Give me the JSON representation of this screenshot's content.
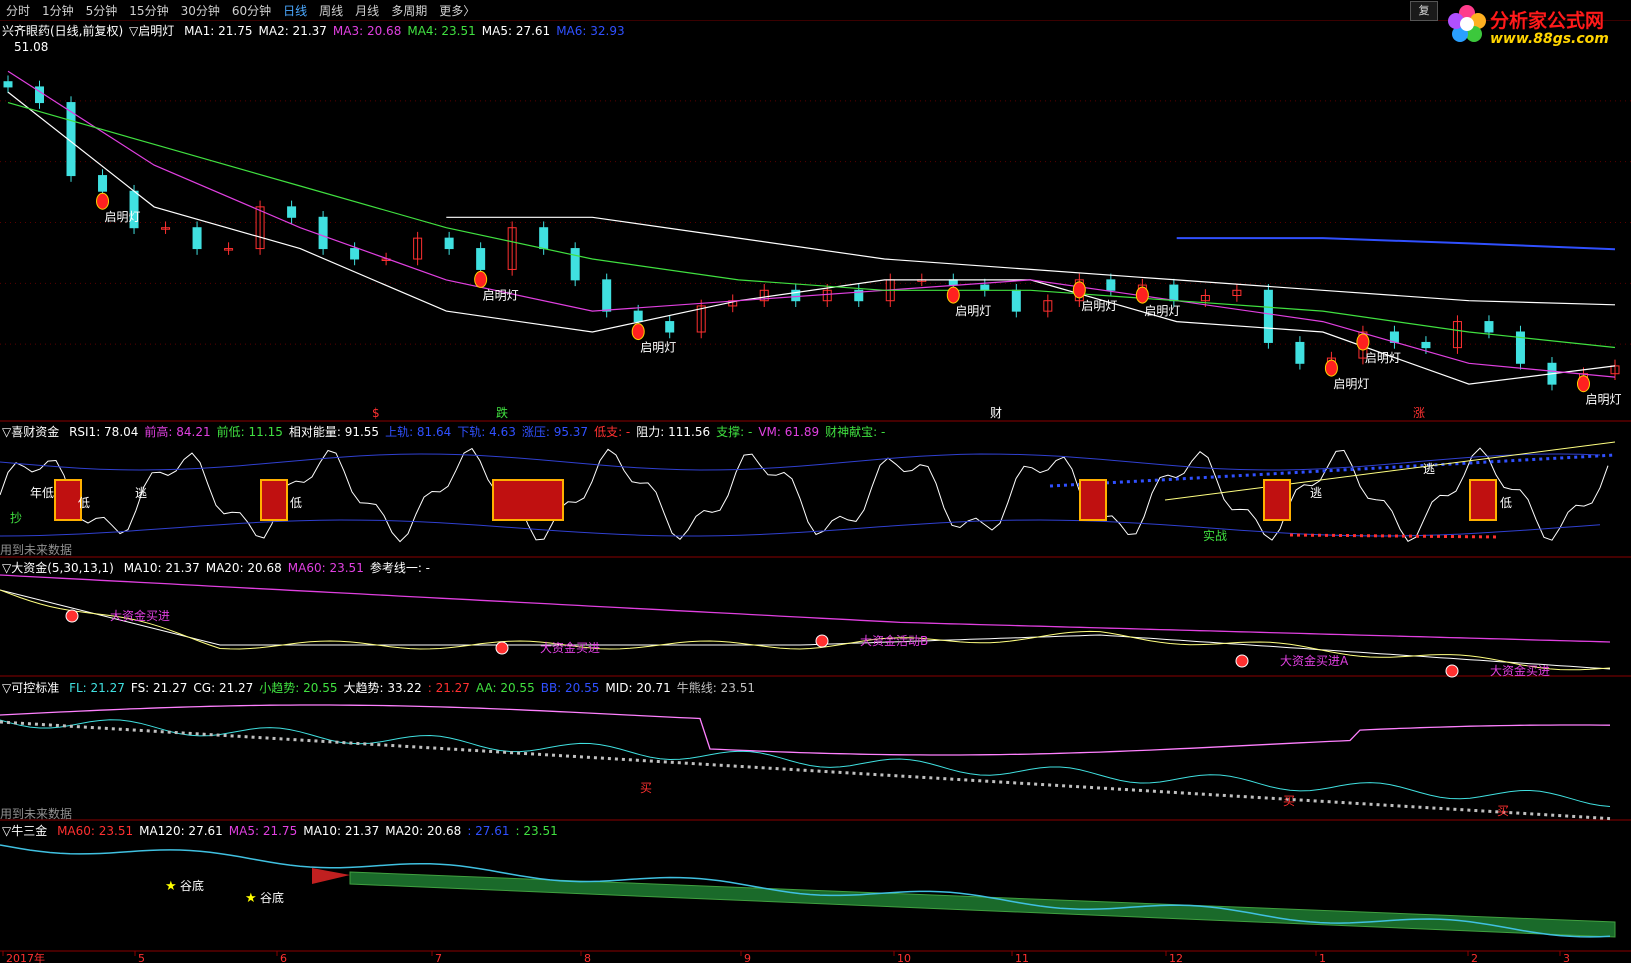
{
  "toolbar": {
    "periods": [
      "分时",
      "1分钟",
      "5分钟",
      "15分钟",
      "30分钟",
      "60分钟",
      "日线",
      "周线",
      "月线",
      "多周期",
      "更多〉"
    ],
    "active": "日线",
    "restore": "复"
  },
  "logo": {
    "title": "分析家公式网",
    "url": "www.88gs.com"
  },
  "main_panel": {
    "stock": "兴齐眼药(日线,前复权)",
    "indicator": "▽启明灯",
    "ma": [
      {
        "label": "MA1: 21.75",
        "color": "#ffffff"
      },
      {
        "label": "MA2: 21.37",
        "color": "#ffffff"
      },
      {
        "label": "MA3: 20.68",
        "color": "#e040e0"
      },
      {
        "label": "MA4: 23.51",
        "color": "#40e040"
      },
      {
        "label": "MA5: 27.61",
        "color": "#ffffff"
      },
      {
        "label": "MA6: 32.93",
        "color": "#3050ff"
      }
    ],
    "high_label": "51.08",
    "signal_labels": [
      "启明灯",
      "启明灯",
      "启明灯",
      "启明灯",
      "启明灯",
      "启明灯",
      "启明灯",
      "启明灯",
      "启明灯"
    ],
    "bottom_markers": [
      {
        "text": "$",
        "color": "#ff3030"
      },
      {
        "text": "跌",
        "color": "#40e040"
      },
      {
        "text": "财",
        "color": "#ffffff"
      },
      {
        "text": "涨",
        "color": "#ff3030"
      }
    ]
  },
  "panel_rsi": {
    "title": "▽喜财资金",
    "items": [
      {
        "label": "RSI1: 78.04",
        "color": "#ffffff"
      },
      {
        "label": "前高: 84.21",
        "color": "#e040e0"
      },
      {
        "label": "前低: 11.15",
        "color": "#40e040"
      },
      {
        "label": "相对能量: 91.55",
        "color": "#ffffff"
      },
      {
        "label": "上轨: 81.64",
        "color": "#3050ff"
      },
      {
        "label": "下轨: 4.63",
        "color": "#3050ff"
      },
      {
        "label": "涨压: 95.37",
        "color": "#3050ff"
      },
      {
        "label": "低支: -",
        "color": "#ff3030"
      },
      {
        "label": "阻力: 111.56",
        "color": "#ffffff"
      },
      {
        "label": "支撑: -",
        "color": "#40e040"
      },
      {
        "label": "VM: 61.89",
        "color": "#e040e0"
      },
      {
        "label": "财神献宝: -",
        "color": "#40e040"
      }
    ],
    "note": "用到未来数据",
    "labels": [
      "年低",
      "低",
      "逃",
      "低",
      "抄",
      "实战",
      "逃",
      "逃",
      "低"
    ]
  },
  "panel_big": {
    "title": "▽大资金(5,30,13,1)",
    "items": [
      {
        "label": "MA10: 21.37",
        "color": "#ffffff"
      },
      {
        "label": "MA20: 20.68",
        "color": "#ffffff"
      },
      {
        "label": "MA60: 23.51",
        "color": "#e040e0"
      },
      {
        "label": "参考线一: -",
        "color": "#ffffff"
      }
    ],
    "annotations": [
      "大资金买进",
      "大资金买进",
      "大资金活动B",
      "大资金买进A",
      "大资金买进"
    ]
  },
  "panel_ctrl": {
    "title": "▽可控标准",
    "items": [
      {
        "label": "FL: 21.27",
        "color": "#40e0e0"
      },
      {
        "label": "FS: 21.27",
        "color": "#ffffff"
      },
      {
        "label": "CG: 21.27",
        "color": "#ffffff"
      },
      {
        "label": "小趋势: 20.55",
        "color": "#40e040"
      },
      {
        "label": "大趋势: 33.22",
        "color": "#ffffff"
      },
      {
        "label": ": 21.27",
        "color": "#ff3030"
      },
      {
        "label": "AA: 20.55",
        "color": "#40e040"
      },
      {
        "label": "BB: 20.55",
        "color": "#3050ff"
      },
      {
        "label": "MID: 20.71",
        "color": "#ffffff"
      },
      {
        "label": "牛熊线: 23.51",
        "color": "#c0c0c0"
      }
    ],
    "note": "用到未来数据",
    "markers": [
      "买",
      "买",
      "买"
    ]
  },
  "panel_bull": {
    "title": "▽牛三金",
    "items": [
      {
        "label": "MA60: 23.51",
        "color": "#ff3030"
      },
      {
        "label": "MA120: 27.61",
        "color": "#ffffff"
      },
      {
        "label": "MA5: 21.75",
        "color": "#e040e0"
      },
      {
        "label": "MA10: 21.37",
        "color": "#ffffff"
      },
      {
        "label": "MA20: 20.68",
        "color": "#ffffff"
      },
      {
        "label": ": 27.61",
        "color": "#3050ff"
      },
      {
        "label": ": 23.51",
        "color": "#40e040"
      }
    ],
    "stars": [
      "谷底",
      "谷底"
    ]
  },
  "x_axis": [
    "2017年",
    "5",
    "6",
    "7",
    "8",
    "9",
    "10",
    "11",
    "12",
    "1",
    "2",
    "3"
  ],
  "chart_data": {
    "type": "line",
    "title": "兴齐眼药(日线,前复权)",
    "xlabel": "",
    "ylabel": "",
    "x": [
      "2017年",
      "5",
      "6",
      "7",
      "8",
      "9",
      "10",
      "11",
      "12",
      "1",
      "2",
      "3"
    ],
    "series": [
      {
        "name": "MA1",
        "values": [
          48,
          37,
          33,
          27,
          25,
          28,
          30,
          30,
          26,
          25,
          20,
          21.75
        ]
      },
      {
        "name": "MA3",
        "values": [
          50,
          41,
          35,
          30,
          27,
          28,
          29,
          30,
          28,
          26,
          22,
          20.68
        ]
      },
      {
        "name": "MA4",
        "values": [
          47,
          43,
          39,
          35,
          32,
          30,
          29,
          29,
          28,
          27,
          25,
          23.51
        ]
      },
      {
        "name": "MA5",
        "values": [
          null,
          null,
          null,
          36,
          36,
          34,
          32,
          31,
          30,
          29,
          28,
          27.61
        ]
      },
      {
        "name": "MA6",
        "values": [
          null,
          null,
          null,
          null,
          null,
          null,
          null,
          null,
          34,
          34,
          33.5,
          32.93
        ]
      }
    ],
    "close": [
      48.5,
      47,
      40,
      38.5,
      35,
      35,
      33,
      33,
      37,
      36,
      33,
      32,
      32,
      34,
      33,
      31,
      35,
      33,
      30,
      27,
      26,
      25,
      27.5,
      28,
      29,
      28,
      29,
      28,
      30,
      30,
      29.5,
      29,
      27,
      28,
      30,
      29,
      29.5,
      28,
      28.5,
      29,
      24,
      22,
      22.5,
      25,
      24,
      23.5,
      26,
      25,
      22,
      20,
      21,
      21.75
    ],
    "annotations": [
      "51.08",
      "启明灯"
    ],
    "ylim": [
      18,
      53
    ],
    "grid": true
  }
}
